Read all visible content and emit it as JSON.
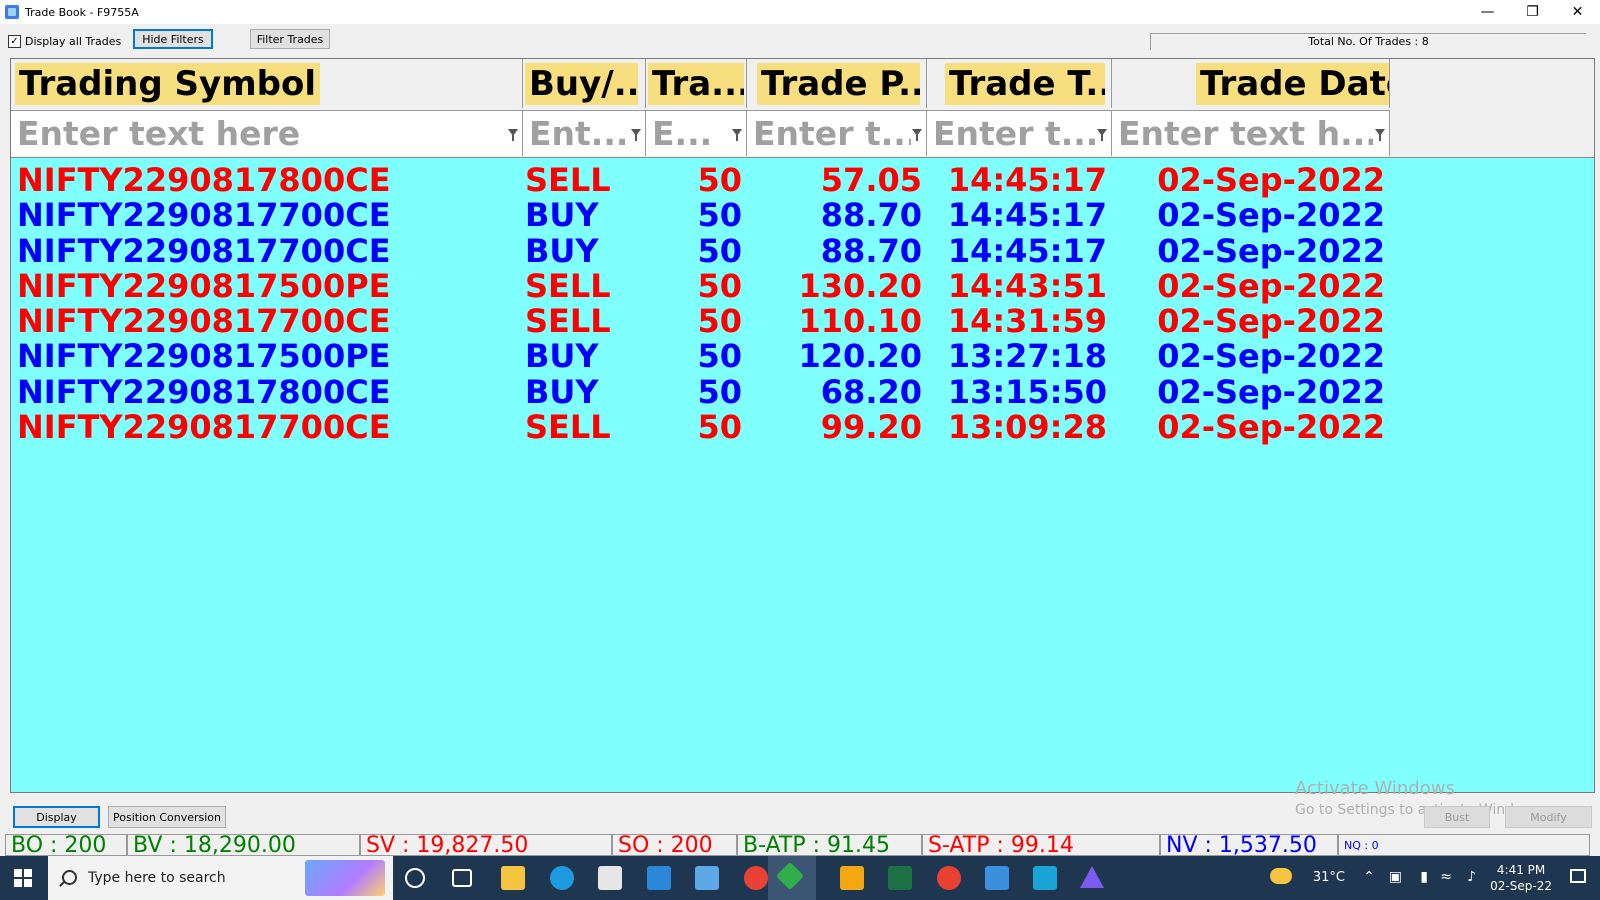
{
  "window": {
    "title": "Trade Book - F9755A"
  },
  "toolbar": {
    "display_all_label": "Display all Trades",
    "display_all_checked": "✓",
    "hide_filters_label": "Hide Filters",
    "filter_trades_label": "Filter Trades",
    "total_trades": "Total No. Of Trades : 8"
  },
  "columns": [
    {
      "header": "Trading Symbol",
      "placeholder": "Enter text here"
    },
    {
      "header": "Buy/...",
      "placeholder": "Ent..."
    },
    {
      "header": "Tra...",
      "placeholder": "E..."
    },
    {
      "header": "Trade P...",
      "placeholder": "Enter t..."
    },
    {
      "header": "Trade T...",
      "placeholder": "Enter t..."
    },
    {
      "header": "Trade Date",
      "placeholder": "Enter text h..."
    }
  ],
  "rows": [
    {
      "symbol": "NIFTY2290817800CE",
      "side": "SELL",
      "qty": "50",
      "price": "57.05",
      "time": "14:45:17",
      "date": "02-Sep-2022"
    },
    {
      "symbol": "NIFTY2290817700CE",
      "side": "BUY",
      "qty": "50",
      "price": "88.70",
      "time": "14:45:17",
      "date": "02-Sep-2022"
    },
    {
      "symbol": "NIFTY2290817700CE",
      "side": "BUY",
      "qty": "50",
      "price": "88.70",
      "time": "14:45:17",
      "date": "02-Sep-2022"
    },
    {
      "symbol": "NIFTY2290817500PE",
      "side": "SELL",
      "qty": "50",
      "price": "130.20",
      "time": "14:43:51",
      "date": "02-Sep-2022"
    },
    {
      "symbol": "NIFTY2290817700CE",
      "side": "SELL",
      "qty": "50",
      "price": "110.10",
      "time": "14:31:59",
      "date": "02-Sep-2022"
    },
    {
      "symbol": "NIFTY2290817500PE",
      "side": "BUY",
      "qty": "50",
      "price": "120.20",
      "time": "13:27:18",
      "date": "02-Sep-2022"
    },
    {
      "symbol": "NIFTY2290817800CE",
      "side": "BUY",
      "qty": "50",
      "price": "68.20",
      "time": "13:15:50",
      "date": "02-Sep-2022"
    },
    {
      "symbol": "NIFTY2290817700CE",
      "side": "SELL",
      "qty": "50",
      "price": "99.20",
      "time": "13:09:28",
      "date": "02-Sep-2022"
    }
  ],
  "bottom": {
    "display_label": "Display",
    "position_conversion_label": "Position Conversion",
    "bust_label": "Bust",
    "modify_label": "Modify",
    "watermark_title": "Activate Windows",
    "watermark_sub": "Go to Settings to activate Windows."
  },
  "status": {
    "bo": "BO : 200",
    "bv": "BV : 18,290.00",
    "sv": "SV : 19,827.50",
    "so": "SO : 200",
    "batp": "B-ATP : 91.45",
    "satp": "S-ATP : 99.14",
    "nv": "NV : 1,537.50",
    "nq": "NQ : 0"
  },
  "taskbar": {
    "search_placeholder": "Type here to search",
    "temperature": "31°C",
    "time": "4:41 PM",
    "date": "02-Sep-22"
  },
  "colors": {
    "grid_bg": "#80ffff",
    "header_bg": "#f7de7e",
    "sell": "#ff0000",
    "buy": "#0000ff",
    "status_green": "#008000",
    "status_red": "#ff0000",
    "status_blue": "#0000ff",
    "taskbar": "#1f3650"
  }
}
